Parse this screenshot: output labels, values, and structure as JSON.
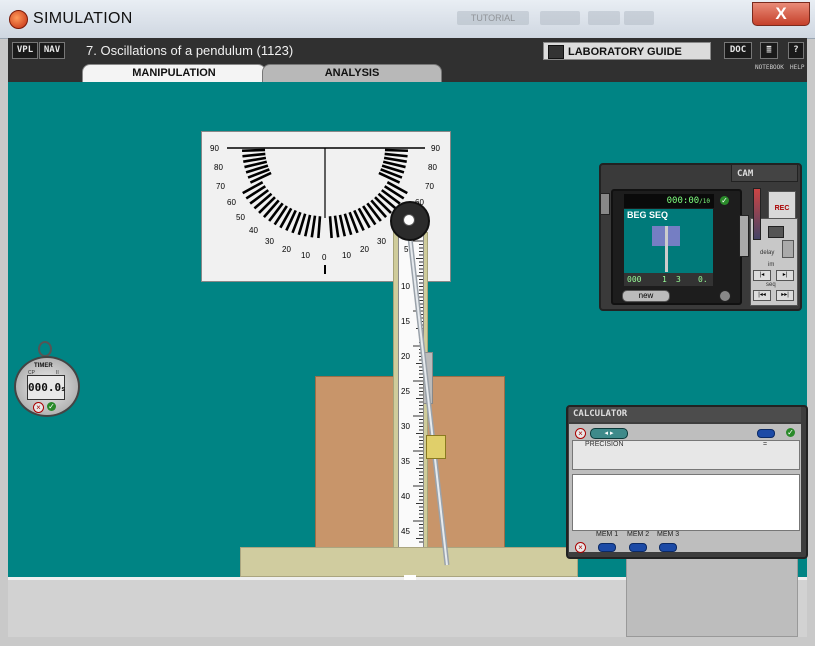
{
  "window": {
    "title": "SIMULATION",
    "close_glyph": "X",
    "faded_buttons": [
      "TUTORIAL",
      "",
      "",
      ""
    ]
  },
  "toolbar": {
    "vpl": "VPL",
    "nav": "NAV",
    "experiment_title": "7. Oscillations of a pendulum (1123)",
    "lab_guide": "LABORATORY GUIDE",
    "doc": "DOC",
    "notebook_glyph": "≣",
    "help_glyph": "?",
    "notebook_label": "NOTEBOOK",
    "help_label": "HELP"
  },
  "tabs": [
    {
      "label": "MANIPULATION",
      "active": true
    },
    {
      "label": "ANALYSIS",
      "active": false
    }
  ],
  "protractor": {
    "left_labels": [
      "90",
      "80",
      "70",
      "60",
      "50",
      "40",
      "30",
      "20",
      "10"
    ],
    "right_labels": [
      "90",
      "80",
      "70",
      "60",
      "50",
      "40",
      "30",
      "20",
      "10"
    ],
    "center_label": "0"
  },
  "ruler": {
    "labels": [
      "5",
      "10",
      "15",
      "20",
      "25",
      "30",
      "35",
      "40",
      "45"
    ]
  },
  "timer": {
    "label": "TIMER",
    "value": "000.0",
    "unit": "s",
    "left_mark": "CP",
    "right_mark": "II"
  },
  "camera": {
    "tab": "CAM",
    "time": "000:00",
    "time_unit": "/10",
    "badge": "BEG SEQ",
    "counter_left": "000",
    "counter_mid1": "1",
    "counter_mid2": "3",
    "counter_right": "0.",
    "new_button": "new",
    "rec": "REC",
    "delay": "delay",
    "im": "im",
    "seq": "seq"
  },
  "calculator": {
    "title": "CALCULATOR",
    "precision": "PRECISION",
    "equals": "=",
    "mem": [
      "MEM 1",
      "MEM 2",
      "MEM 3"
    ]
  },
  "colors": {
    "simulation_bg": "#008484",
    "box": "#c8956a",
    "stand": "#cfcc9b"
  }
}
